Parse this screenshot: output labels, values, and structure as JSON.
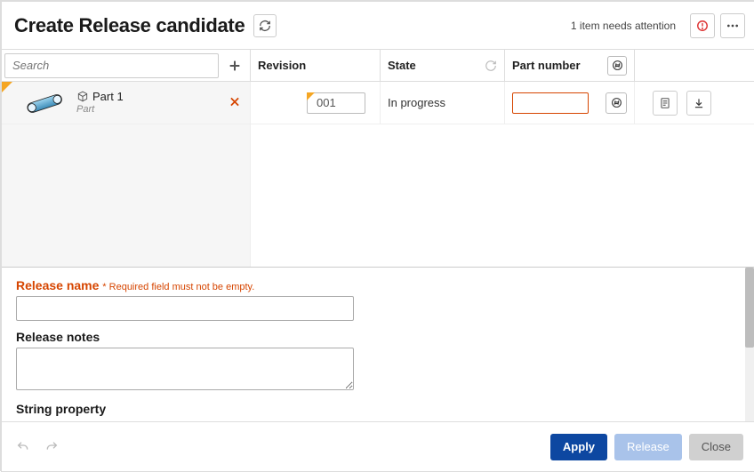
{
  "header": {
    "title": "Create Release candidate",
    "attention_text": "1 item needs attention"
  },
  "columns": {
    "search_placeholder": "Search",
    "revision": "Revision",
    "state": "State",
    "part_number": "Part number"
  },
  "rows": [
    {
      "name": "Part 1",
      "type_label": "Part",
      "revision": "001",
      "state": "In progress",
      "part_number": ""
    }
  ],
  "form": {
    "release_name_label": "Release name",
    "release_name_error": "* Required field must not be empty.",
    "release_name_value": "",
    "release_notes_label": "Release notes",
    "release_notes_value": "",
    "string_prop_label": "String property"
  },
  "footer": {
    "apply": "Apply",
    "release": "Release",
    "close": "Close"
  }
}
